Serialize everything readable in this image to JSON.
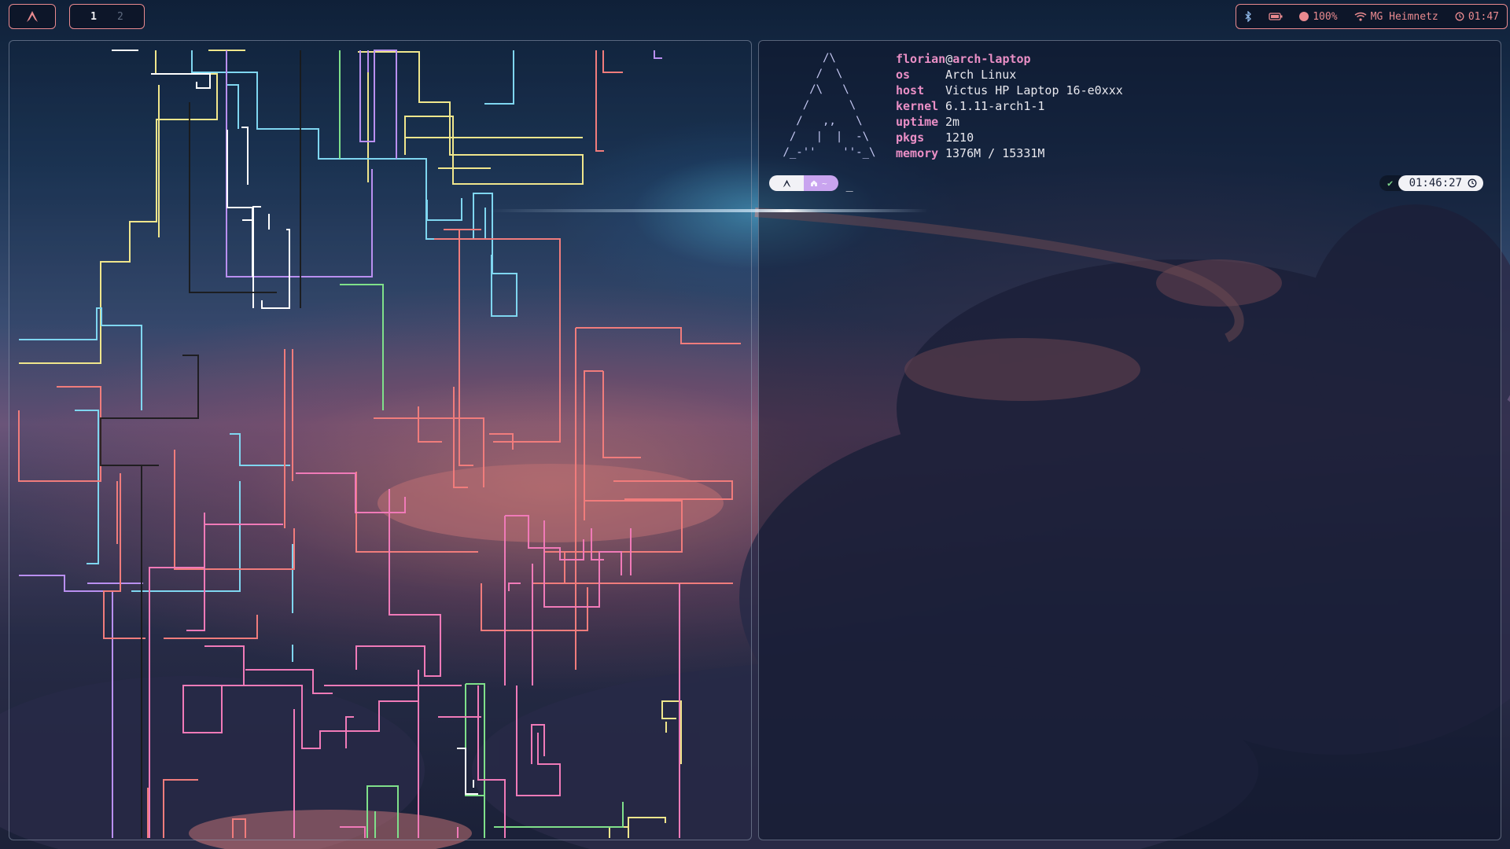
{
  "top_bar": {
    "arch_icon": "arch-logo-icon",
    "workspaces": [
      {
        "label": "1",
        "active": true
      },
      {
        "label": "2",
        "active": false
      }
    ],
    "status": {
      "bluetooth_icon": "bluetooth-icon",
      "battery_icon": "battery-icon",
      "battery_percent": "100%",
      "wifi_icon": "wifi-icon",
      "network_name": "MG Heimnetz",
      "clock_icon": "clock-icon",
      "time": "01:47"
    },
    "accent_color": "#e98a8f"
  },
  "terminal_right": {
    "fetch": {
      "user": "florian",
      "at": "@",
      "host": "arch-laptop",
      "rows": [
        {
          "key": "os",
          "value": "Arch Linux"
        },
        {
          "key": "host",
          "value": "Victus HP Laptop 16-e0xxx"
        },
        {
          "key": "kernel",
          "value": "6.1.11-arch1-1"
        },
        {
          "key": "uptime",
          "value": "2m"
        },
        {
          "key": "pkgs",
          "value": "1210"
        },
        {
          "key": "memory",
          "value": "1376M / 15331M"
        }
      ],
      "logo_color": "#c6c9f4",
      "key_color": "#ea8fc6"
    },
    "prompt": {
      "os_icon": "arch-logo-icon",
      "dir_icon": "home-icon",
      "dir": "~",
      "cursor": "_",
      "status_icon": "check-icon",
      "time": "01:46:27",
      "time_icon": "clock-icon",
      "dir_color": "#c9a4ef"
    }
  },
  "terminal_left": {
    "content": "pipes-screensaver",
    "pipe_colors": [
      "#f0e68c",
      "#7fd6f0",
      "#b98ff0",
      "#7fe08a",
      "#f07c7c",
      "#f07ab8",
      "#ffffff",
      "#1a1a1a"
    ]
  }
}
